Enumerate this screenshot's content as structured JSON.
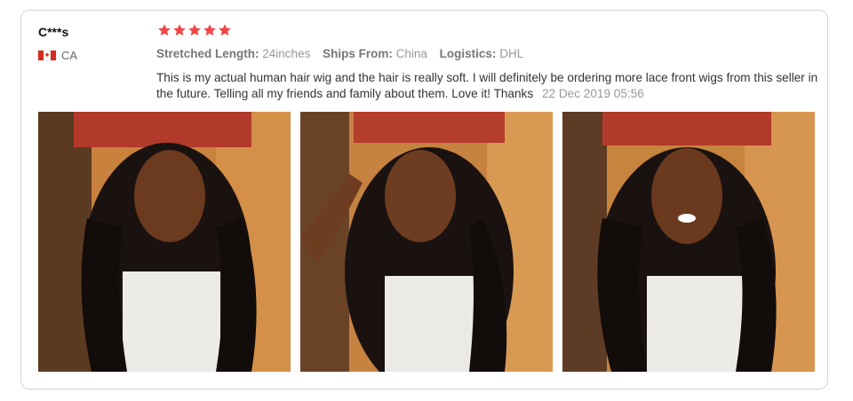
{
  "review": {
    "reviewer": "C***s",
    "country_code": "CA",
    "flag_icon": "canada-flag-icon",
    "rating": 5,
    "star_color": "#f04848",
    "attributes": [
      {
        "key": "Stretched Length:",
        "value": "24inches"
      },
      {
        "key": "Ships From:",
        "value": "China"
      },
      {
        "key": "Logistics:",
        "value": "DHL"
      }
    ],
    "text": "This is my actual human hair wig and the hair is really soft. I will definitely be ordering more lace front wigs from this seller in the future. Telling all my friends and family about them. Love it! Thanks",
    "date": "22 Dec 2019 05:56"
  }
}
